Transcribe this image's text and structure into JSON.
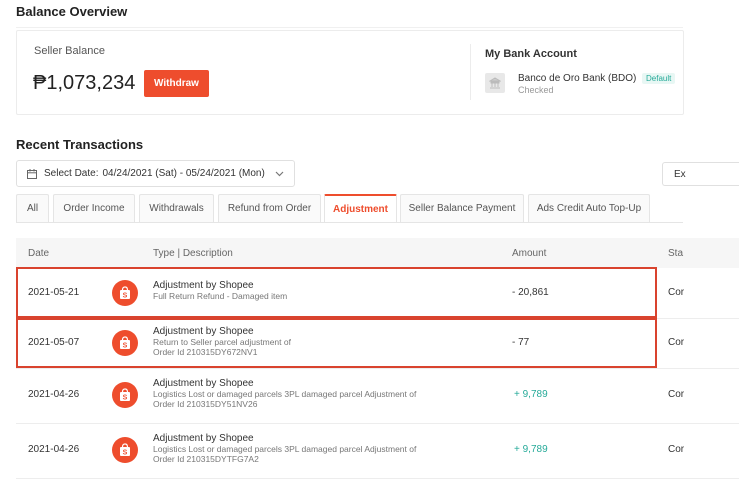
{
  "balance_overview": {
    "title": "Balance Overview"
  },
  "seller_balance": {
    "label": "Seller Balance",
    "amount": "₱1,073,234",
    "withdraw_label": "Withdraw"
  },
  "bank": {
    "title": "My Bank Account",
    "name": "Banco de Oro Bank (BDO)",
    "status": "Checked",
    "badge": "Default"
  },
  "recent": {
    "title": "Recent Transactions",
    "date_label": "Select Date:",
    "date_range": "04/24/2021 (Sat) - 05/24/2021 (Mon)",
    "export_label": "Ex"
  },
  "tabs": [
    "All",
    "Order Income",
    "Withdrawals",
    "Refund from Order",
    "Adjustment",
    "Seller Balance Payment",
    "Ads Credit Auto Top-Up"
  ],
  "active_tab": "Adjustment",
  "table": {
    "headers": {
      "date": "Date",
      "type": "Type | Description",
      "amount": "Amount",
      "status": "Sta"
    },
    "rows": [
      {
        "date": "2021-05-21",
        "title": "Adjustment by Shopee",
        "line1": "Full Return Refund - Damaged item",
        "line2": "",
        "amount": "- 20,861",
        "status": "Cor"
      },
      {
        "date": "2021-05-07",
        "title": "Adjustment by Shopee",
        "line1": "Return to Seller parcel adjustment of",
        "line2": "Order Id 210315DY672NV1",
        "amount": "- 77",
        "status": "Cor"
      },
      {
        "date": "2021-04-26",
        "title": "Adjustment by Shopee",
        "line1": "Logistics Lost or damaged parcels 3PL damaged parcel Adjustment of",
        "line2": "Order Id 210315DY51NV26",
        "amount": "+ 9,789",
        "status": "Cor"
      },
      {
        "date": "2021-04-26",
        "title": "Adjustment by Shopee",
        "line1": "Logistics Lost or damaged parcels 3PL damaged parcel Adjustment of",
        "line2": "Order Id 210315DYTFG7A2",
        "amount": "+ 9,789",
        "status": "Cor"
      }
    ]
  },
  "colors": {
    "brand": "#ee4d2d",
    "highlight": "#d9432e",
    "positive": "#26aa99"
  },
  "icons": {
    "calendar": "calendar-icon",
    "chevron": "chevron-down-icon",
    "bank": "bank-icon",
    "shopee": "shopee-bag-icon"
  }
}
